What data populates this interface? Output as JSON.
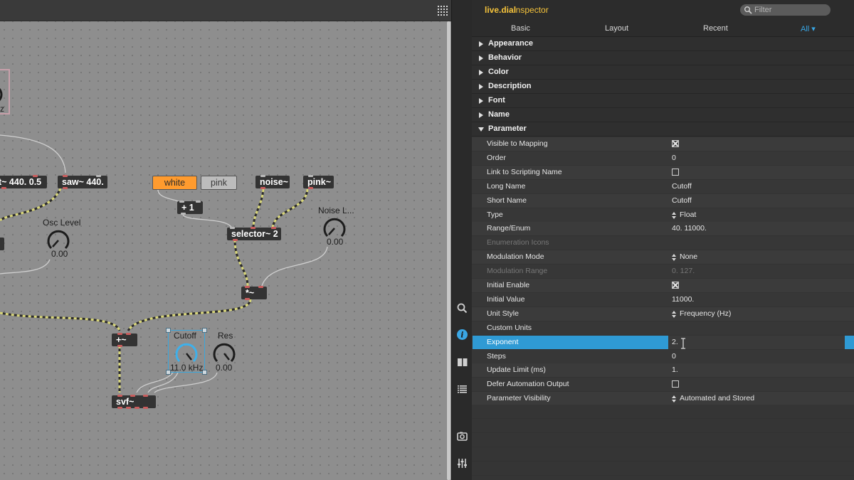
{
  "patcher": {
    "objects": {
      "osc_partial": "t~ 440. 0.5",
      "saw": "saw~ 440.",
      "noise": "noise~",
      "pink_obj": "pink~",
      "plus_one": "+ 1",
      "selector": "selector~ 2",
      "mult": "*~",
      "plus": "+~",
      "svf": "svf~",
      "hz_partial": "z"
    },
    "messages": {
      "white": "white",
      "pink": "pink"
    },
    "dials": {
      "osc_level": {
        "label": "Osc Level",
        "value": "0.00"
      },
      "noise_level": {
        "label": "Noise L...",
        "value": "0.00"
      },
      "cutoff": {
        "label": "Cutoff",
        "value": "11.0 kHz"
      },
      "res": {
        "label": "Res",
        "value": "0.00"
      }
    },
    "colors": {
      "signal_wire": "#d9d77a",
      "message_orange": "#ff9b2e",
      "selection": "#3aa6dc"
    }
  },
  "inspector": {
    "title_object": "live.dial",
    "title_suffix": "inspector",
    "filter_placeholder": "Filter",
    "tabs": [
      "Basic",
      "Layout",
      "Recent",
      "All ▾"
    ],
    "active_tab": "All ▾",
    "sections": [
      "Appearance",
      "Behavior",
      "Color",
      "Description",
      "Font",
      "Name",
      "Parameter"
    ],
    "parameter_rows": [
      {
        "name": "Visible to Mapping",
        "kind": "checkbox",
        "checked": true
      },
      {
        "name": "Order",
        "kind": "text",
        "value": "0"
      },
      {
        "name": "Link to Scripting Name",
        "kind": "checkbox",
        "checked": false
      },
      {
        "name": "Long Name",
        "kind": "text",
        "value": "Cutoff"
      },
      {
        "name": "Short Name",
        "kind": "text",
        "value": "Cutoff"
      },
      {
        "name": "Type",
        "kind": "enum",
        "value": "Float"
      },
      {
        "name": "Range/Enum",
        "kind": "text",
        "value": "40. 11000."
      },
      {
        "name": "Enumeration Icons",
        "kind": "disabled",
        "value": ""
      },
      {
        "name": "Modulation Mode",
        "kind": "enum",
        "value": "None"
      },
      {
        "name": "Modulation Range",
        "kind": "disabled",
        "value": "0. 127."
      },
      {
        "name": "Initial Enable",
        "kind": "checkbox",
        "checked": true
      },
      {
        "name": "Initial Value",
        "kind": "text",
        "value": "11000."
      },
      {
        "name": "Unit Style",
        "kind": "enum",
        "value": "Frequency (Hz)"
      },
      {
        "name": "Custom Units",
        "kind": "text",
        "value": ""
      },
      {
        "name": "Exponent",
        "kind": "selected",
        "value": "2."
      },
      {
        "name": "Steps",
        "kind": "text",
        "value": "0"
      },
      {
        "name": "Update Limit (ms)",
        "kind": "text",
        "value": "1."
      },
      {
        "name": "Defer Automation Output",
        "kind": "checkbox",
        "checked": false
      },
      {
        "name": "Parameter Visibility",
        "kind": "enum",
        "value": "Automated and Stored"
      }
    ],
    "accent": "#2f9ad4"
  },
  "side_toolbar": [
    "search-icon",
    "info-icon",
    "columns-icon",
    "list-icon",
    "camera-icon",
    "mixer-sliders-icon"
  ]
}
